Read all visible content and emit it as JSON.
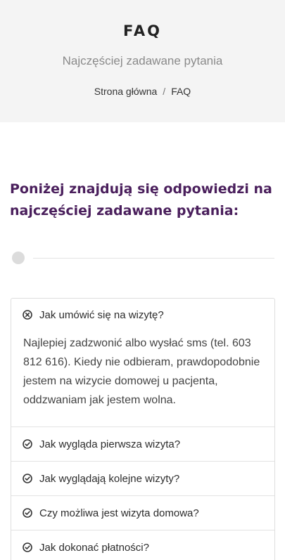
{
  "header": {
    "title": "FAQ",
    "subtitle": "Najczęściej zadawane pytania",
    "breadcrumb": {
      "home": "Strona główna",
      "separator": "/",
      "current": "FAQ"
    }
  },
  "intro": {
    "heading": "Poniżej znajdują się odpowiedzi na najczęściej zadawane pytania:"
  },
  "faq": {
    "items": [
      {
        "question": "Jak umówić się na wizytę?",
        "answer": "Najlepiej zadzwonić albo wysłać sms (tel. 603 812 616). Kiedy nie odbieram, prawdopodobnie jestem na wizycie domowej u pacjenta, oddzwaniam jak jestem wolna.",
        "state": "expanded",
        "icon": "close-circle-icon"
      },
      {
        "question": "Jak wygląda pierwsza wizyta?",
        "state": "collapsed",
        "icon": "check-circle-icon"
      },
      {
        "question": "Jak wyglądają kolejne wizyty?",
        "state": "collapsed",
        "icon": "check-circle-icon"
      },
      {
        "question": "Czy możliwa jest wizyta domowa?",
        "state": "collapsed",
        "icon": "check-circle-icon"
      },
      {
        "question": "Jak dokonać płatności?",
        "state": "collapsed",
        "icon": "check-circle-icon"
      }
    ]
  },
  "colors": {
    "heading_accent": "#4a1f5c",
    "hero_background": "#f4f4f4"
  }
}
